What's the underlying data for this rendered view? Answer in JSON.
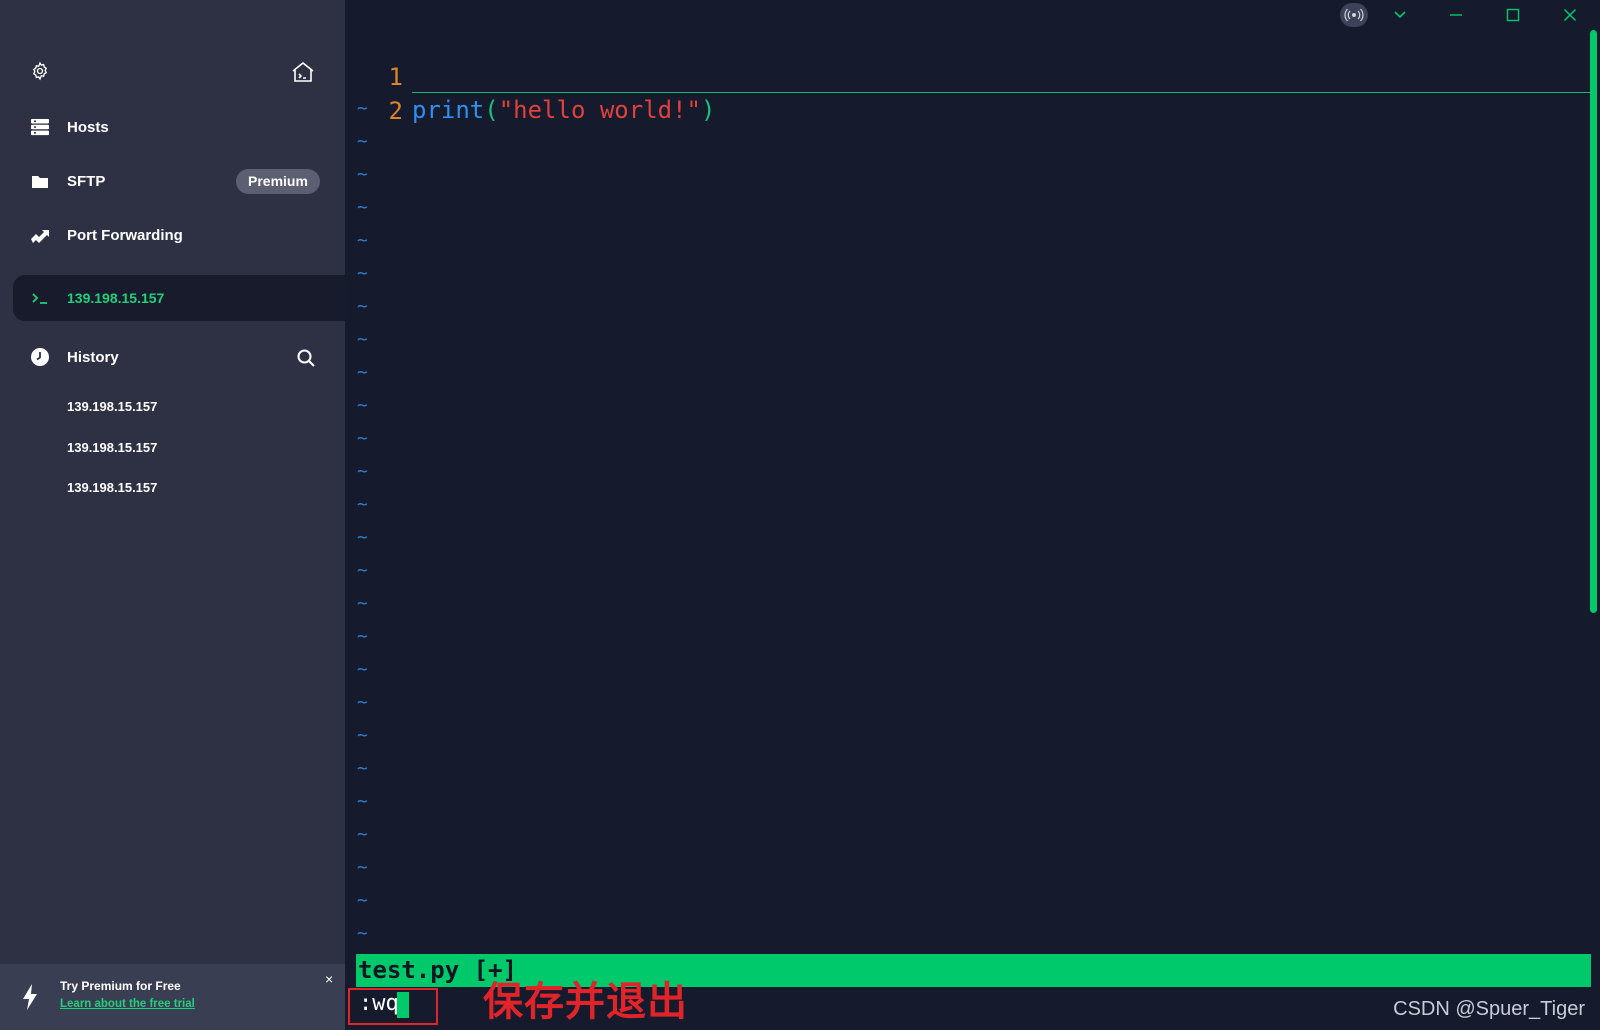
{
  "sidebar": {
    "settings_icon": "gear-icon",
    "home_icon": "home-terminal-icon",
    "nav": [
      {
        "label": "Hosts",
        "icon": "hosts-grid-icon"
      },
      {
        "label": "SFTP",
        "icon": "folder-icon",
        "badge": "Premium"
      },
      {
        "label": "Port Forwarding",
        "icon": "port-forward-icon"
      }
    ],
    "active_session": {
      "label": "139.198.15.157",
      "icon": "terminal-prompt-icon"
    },
    "history": {
      "label": "History",
      "icon": "clock-icon",
      "search_icon": "search-icon",
      "items": [
        "139.198.15.157",
        "139.198.15.157",
        "139.198.15.157"
      ]
    },
    "promo": {
      "icon": "lightning-icon",
      "title": "Try Premium for Free",
      "link": "Learn about the free trial",
      "close": "×"
    }
  },
  "editor": {
    "lines": [
      {
        "num": "1",
        "fn": "print",
        "open": "(",
        "str": "\"hello world!\"",
        "close": ")"
      },
      {
        "num": "2"
      }
    ],
    "empty_marker": "~",
    "status_line": "test.py [+]",
    "command": ":wq",
    "annotation": "保存并退出"
  },
  "window": {
    "controls": [
      "broadcast-icon",
      "chevron-down-icon",
      "minimize-icon",
      "maximize-icon",
      "close-icon"
    ]
  },
  "watermark": "CSDN @Spuer_Tiger",
  "colors": {
    "sidebar_bg": "#2d3143",
    "editor_bg": "#151a2c",
    "accent_green": "#00c96c",
    "line_number": "#d9862b",
    "string": "#e0403e",
    "function": "#2e8ff0",
    "tilde": "#2d7fcf",
    "annotation_red": "#e0242a"
  }
}
